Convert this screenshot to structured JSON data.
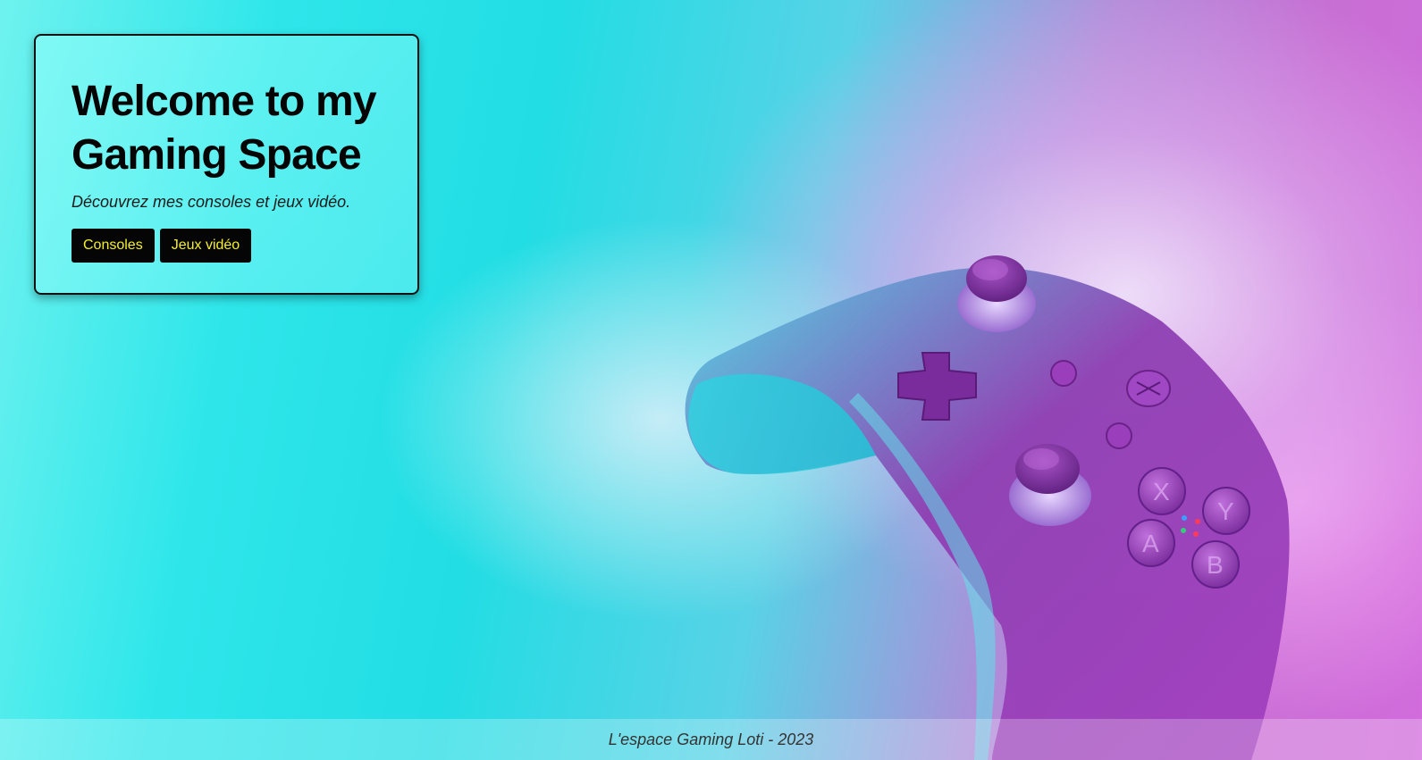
{
  "hero": {
    "title": "Welcome to my Gaming Space",
    "subtitle": "Découvrez mes consoles et jeux vidéo.",
    "buttons": [
      {
        "label": "Consoles"
      },
      {
        "label": "Jeux vidéo"
      }
    ]
  },
  "background": {
    "image": "game-controller-photo",
    "colors": {
      "cyan": "#22dde4",
      "magenta": "#d26bdc",
      "controller_purple": "#8a2fa8"
    }
  },
  "footer": {
    "text": "L'espace Gaming Loti - 2023"
  },
  "colors": {
    "button_bg": "#050505",
    "button_text": "#f6f02a",
    "card_border": "#111111"
  }
}
